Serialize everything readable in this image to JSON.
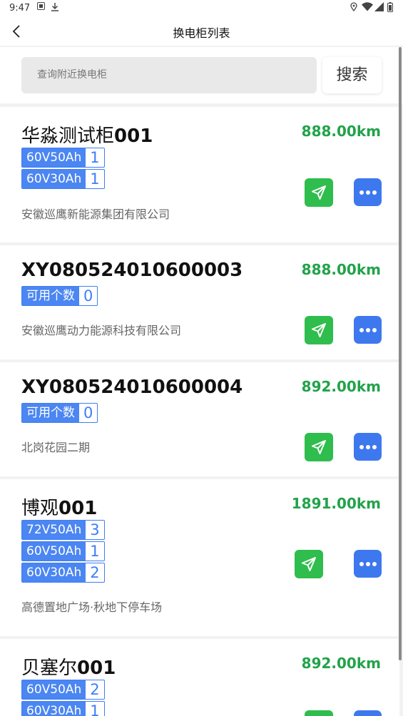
{
  "status_bar": {
    "time": "9:47",
    "icons": [
      "notification-icon",
      "download-icon",
      "location-icon",
      "wifi-icon",
      "signal-icon",
      "battery-icon"
    ]
  },
  "header": {
    "title": "换电柜列表",
    "back_icon": "chevron-left-icon"
  },
  "search": {
    "placeholder": "查询附近换电柜",
    "button_label": "搜索"
  },
  "colors": {
    "distance": "#22a34a",
    "badge": "#4b86f2",
    "nav_button": "#2fbd4d",
    "more_button": "#3e78ee"
  },
  "cabinets": [
    {
      "name_zh": "华淼测试柜",
      "name_code": "001",
      "distance": "888.00km",
      "badges": [
        {
          "label": "60V50Ah",
          "count": "1"
        },
        {
          "label": "60V30Ah",
          "count": "1"
        }
      ],
      "company": "安徽巡鹰新能源集团有限公司"
    },
    {
      "name_zh": "",
      "name_code": "XY080524010600003",
      "distance": "888.00km",
      "badges": [
        {
          "label": "可用个数",
          "count": "0"
        }
      ],
      "company": "安徽巡鹰动力能源科技有限公司"
    },
    {
      "name_zh": "",
      "name_code": "XY080524010600004",
      "distance": "892.00km",
      "badges": [
        {
          "label": "可用个数",
          "count": "0"
        }
      ],
      "company": "北岗花园二期"
    },
    {
      "name_zh": "博观",
      "name_code": "001",
      "distance": "1891.00km",
      "badges": [
        {
          "label": "72V50Ah",
          "count": "3"
        },
        {
          "label": "60V50Ah",
          "count": "1"
        },
        {
          "label": "60V30Ah",
          "count": "2"
        }
      ],
      "company": "高德置地广场·秋地下停车场"
    },
    {
      "name_zh": "贝塞尔",
      "name_code": "001",
      "distance": "892.00km",
      "badges": [
        {
          "label": "60V50Ah",
          "count": "2"
        },
        {
          "label": "60V30Ah",
          "count": "1"
        }
      ],
      "company": ""
    }
  ]
}
